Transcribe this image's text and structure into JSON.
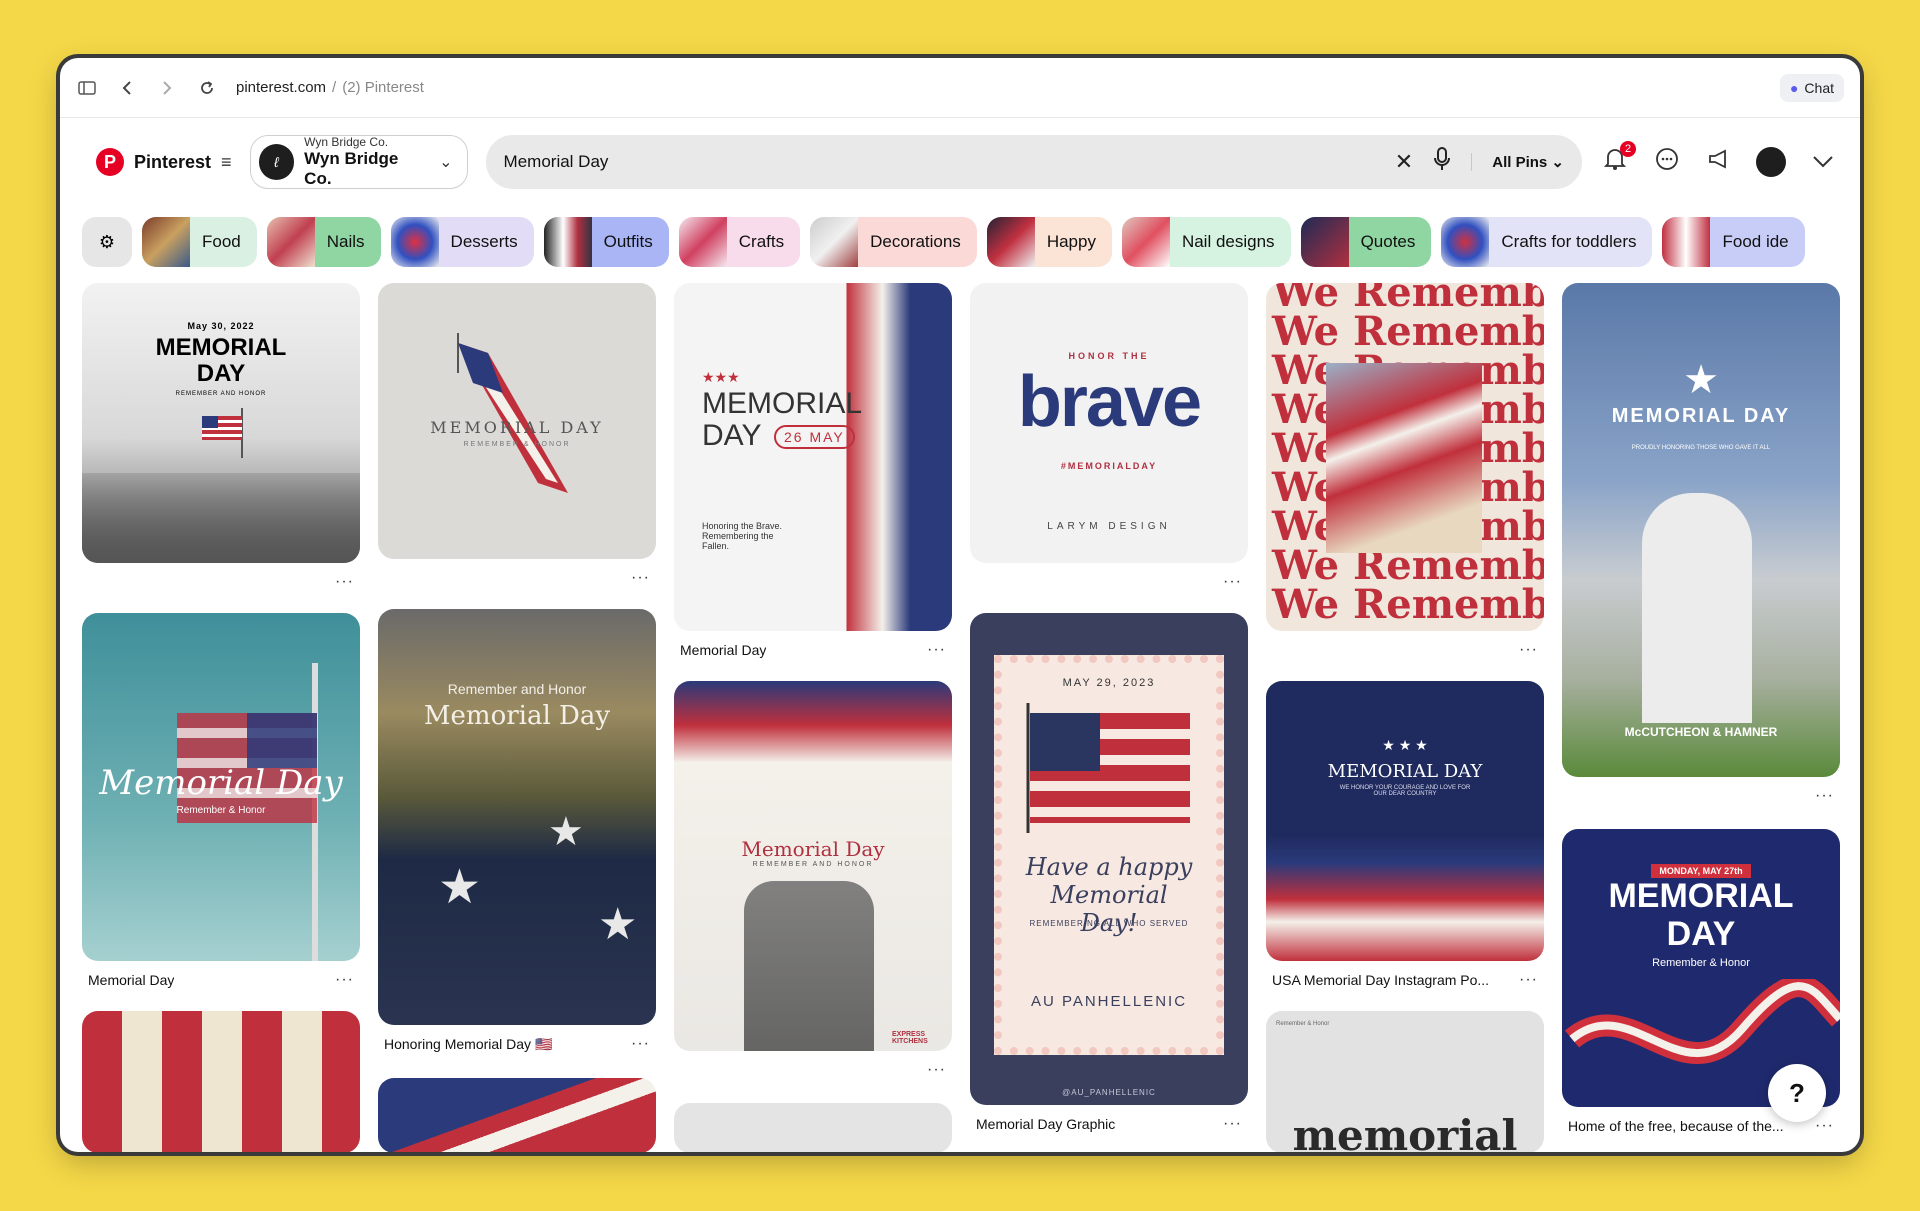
{
  "browser": {
    "domain": "pinterest.com",
    "separator": "/",
    "page": "(2) Pinterest",
    "chat_label": "Chat"
  },
  "header": {
    "brand": "Pinterest",
    "account_small": "Wyn Bridge Co.",
    "account_big": "Wyn Bridge Co.",
    "search_value": "Memorial Day",
    "filter_label": "All Pins",
    "notifications_count": "2"
  },
  "chips": [
    {
      "label": "Food",
      "bg": "#d9f0e2"
    },
    {
      "label": "Nails",
      "bg": "#8fd6a3"
    },
    {
      "label": "Desserts",
      "bg": "#e3dcf7"
    },
    {
      "label": "Outfits",
      "bg": "#a9b5f5"
    },
    {
      "label": "Crafts",
      "bg": "#f8dcec"
    },
    {
      "label": "Decorations",
      "bg": "#fbd9d6"
    },
    {
      "label": "Happy",
      "bg": "#fbe3d6"
    },
    {
      "label": "Nail designs",
      "bg": "#d6f2e0"
    },
    {
      "label": "Quotes",
      "bg": "#8fd6a3"
    },
    {
      "label": "Crafts for toddlers",
      "bg": "#e3e3f8"
    },
    {
      "label": "Food ide",
      "bg": "#c8cdf7"
    }
  ],
  "pins": {
    "p1": {
      "date": "May 30, 2022",
      "title": "MEMORIAL DAY",
      "sub": "REMEMBER AND HONOR"
    },
    "p2": {
      "title": "MEMORIAL DAY",
      "sub": "REMEMBER & HONOR"
    },
    "p3": {
      "stars": "★★★",
      "line1": "MEMORIAL",
      "line2": "DAY",
      "date": "26 MAY",
      "quote": "Honoring the Brave. Remembering the Fallen.",
      "caption": "Memorial Day"
    },
    "p4": {
      "top": "HONOR THE",
      "big": "brave",
      "tag": "#MEMORIALDAY",
      "credit": "LARYM DESIGN"
    },
    "p5": {
      "text": "We Remember"
    },
    "p6": {
      "title": "MEMORIAL DAY",
      "sub": "PROUDLY HONORING THOSE WHO GAVE IT ALL",
      "firm": "McCUTCHEON & HAMNER"
    },
    "p7": {
      "title": "Memorial Day",
      "sub": "Remember & Honor",
      "caption": "Memorial Day"
    },
    "p8": {
      "top": "Remember and Honor",
      "title": "Memorial Day",
      "caption": "Honoring Memorial Day 🇺🇸"
    },
    "p9": {
      "title": "Memorial Day",
      "sub": "REMEMBER AND HONOR",
      "brand": "EXPRESS KITCHENS"
    },
    "p10": {
      "date": "MAY 29, 2023",
      "script": "Have a happy Memorial Day!",
      "sub": "REMEMBERING ALL WHO SERVED",
      "org": "AU PANHELLENIC",
      "handle": "@AU_PANHELLENIC",
      "caption": "Memorial Day Graphic"
    },
    "p11": {
      "title": "MEMORIAL DAY",
      "sub": "WE HONOR YOUR COURAGE AND LOVE FOR OUR DEAR COUNTRY",
      "caption": "USA Memorial Day Instagram Po..."
    },
    "p12": {
      "badge": "MONDAY, MAY 27th",
      "line1": "MEMORIAL",
      "line2": "DAY",
      "sub": "Remember & Honor",
      "caption": "Home of the free, because of the..."
    },
    "p13": {
      "top": "Remember & Honor",
      "word": "memorial"
    }
  },
  "more_label": "···",
  "help_label": "?"
}
